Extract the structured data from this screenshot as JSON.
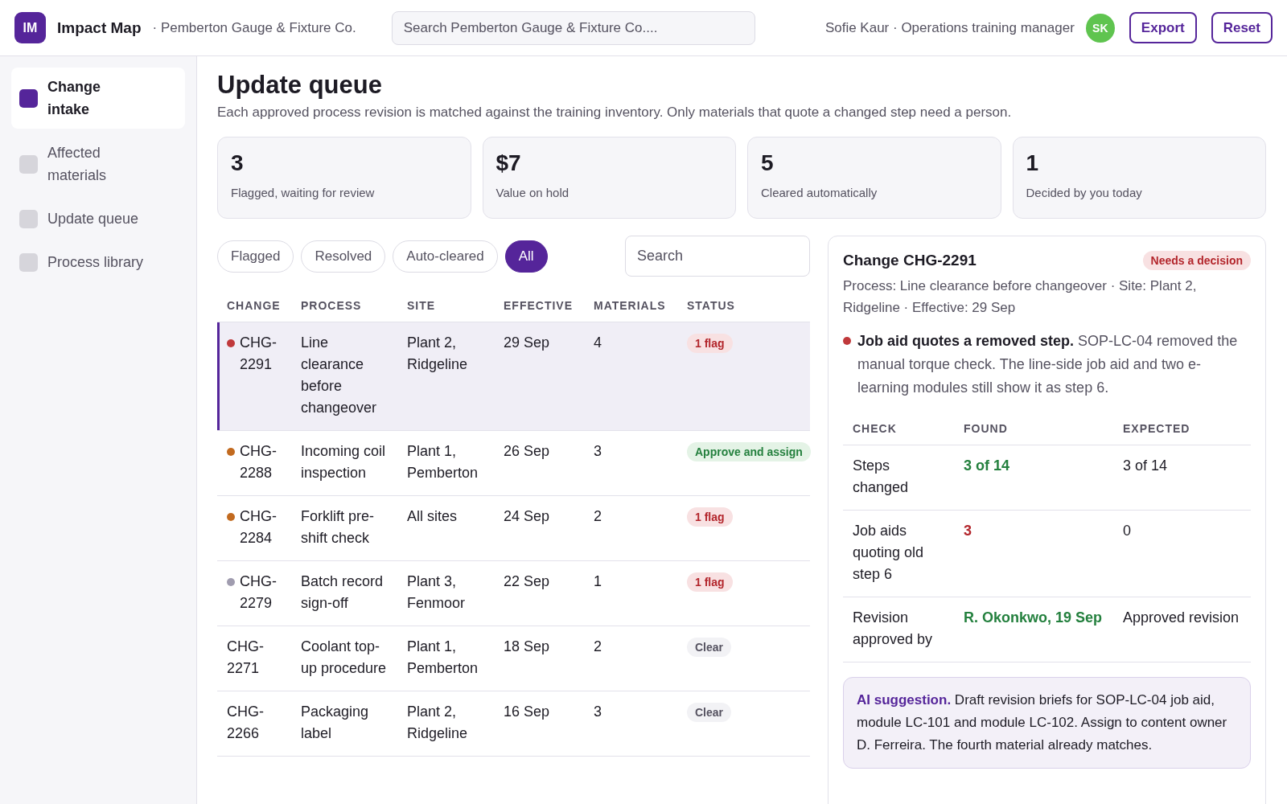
{
  "header": {
    "logo": "IM",
    "app_name": "Impact Map",
    "org": "· Pemberton Gauge & Fixture Co.",
    "search": {
      "placeholder": "Search Pemberton Gauge & Fixture Co...."
    },
    "user": "Sofie Kaur · Operations training manager",
    "avatar": "SK",
    "buttons": [
      "Export",
      "Reset"
    ]
  },
  "sidebar": {
    "items": [
      {
        "label": "Change intake",
        "selected": true
      },
      {
        "label": "Affected materials",
        "selected": false
      },
      {
        "label": "Update queue",
        "selected": false
      },
      {
        "label": "Process library",
        "selected": false
      }
    ]
  },
  "page": {
    "title": "Update queue",
    "subtitle": "Each approved process revision is matched against the training inventory. Only materials that quote a changed step need a person."
  },
  "stats": [
    {
      "value": "3",
      "label": "Flagged, waiting for review"
    },
    {
      "value": "$7",
      "label": "Value on hold"
    },
    {
      "value": "5",
      "label": "Cleared automatically"
    },
    {
      "value": "1",
      "label": "Decided by you today"
    }
  ],
  "filters": [
    {
      "label": "Flagged",
      "selected": false
    },
    {
      "label": "Resolved",
      "selected": false
    },
    {
      "label": "Auto-cleared",
      "selected": false
    },
    {
      "label": "All",
      "selected": true
    }
  ],
  "table_search": {
    "placeholder": "Search"
  },
  "table": {
    "columns": [
      "CHANGE",
      "PROCESS",
      "SITE",
      "EFFECTIVE",
      "MATERIALS",
      "STATUS"
    ],
    "rows": [
      {
        "change": "CHG-2291",
        "color": "#c0393b",
        "process": "Line clearance before changeover",
        "site": "Plant 2, Ridgeline",
        "effective": "29 Sep",
        "materials": "4",
        "status": {
          "kind": "flag",
          "label": "1 flag"
        },
        "selected": true
      },
      {
        "change": "CHG-2288",
        "color": "#c26a1f",
        "process": "Incoming coil inspection",
        "site": "Plant 1, Pemberton",
        "effective": "26 Sep",
        "materials": "3",
        "status": {
          "kind": "approve",
          "label": "Approve and assign"
        },
        "selected": false
      },
      {
        "change": "CHG-2284",
        "color": "#c26a1f",
        "process": "Forklift pre-shift check",
        "site": "All sites",
        "effective": "24 Sep",
        "materials": "2",
        "status": {
          "kind": "flag",
          "label": "1 flag"
        },
        "selected": false
      },
      {
        "change": "CHG-2279",
        "color": "#a09caf",
        "process": "Batch record sign-off",
        "site": "Plant 3, Fenmoor",
        "effective": "22 Sep",
        "materials": "1",
        "status": {
          "kind": "flag",
          "label": "1 flag"
        },
        "selected": false
      },
      {
        "change": "CHG-2271",
        "process": "Coolant top-up procedure",
        "site": "Plant 1, Pemberton",
        "effective": "18 Sep",
        "materials": "2",
        "status": {
          "kind": "clear",
          "label": "Clear"
        },
        "selected": false
      },
      {
        "change": "CHG-2266",
        "process": "Packaging label",
        "site": "Plant 2, Ridgeline",
        "effective": "16 Sep",
        "materials": "3",
        "status": {
          "kind": "clear",
          "label": "Clear"
        },
        "selected": false
      }
    ]
  },
  "detail": {
    "title": "Change CHG-2291",
    "badge": "Needs a decision",
    "meta": "Process: Line clearance before changeover · Site: Plant 2, Ridgeline · Effective: 29 Sep",
    "finding": "**Job aid quotes a removed step.** SOP-LC-04 removed the manual torque check. The line-side job aid and two e-learning modules still show it as step 6.",
    "columns": [
      "CHECK",
      "FOUND",
      "EXPECTED"
    ],
    "checks": [
      {
        "check": "Steps changed",
        "found": "3 of 14",
        "kind": "ok",
        "expected": "3 of 14"
      },
      {
        "check": "Job aids quoting old step 6",
        "found": "3",
        "kind": "bad",
        "expected": "0"
      },
      {
        "check": "Revision approved by",
        "found": "R. Okonkwo, 19 Sep",
        "kind": "ok",
        "expected": "Approved revision"
      }
    ],
    "suggestion": "**AI suggestion.** Draft revision briefs for SOP-LC-04 job aid, module LC-101 and module LC-102. Assign to content owner D. Ferreira. The fourth material already matches."
  }
}
